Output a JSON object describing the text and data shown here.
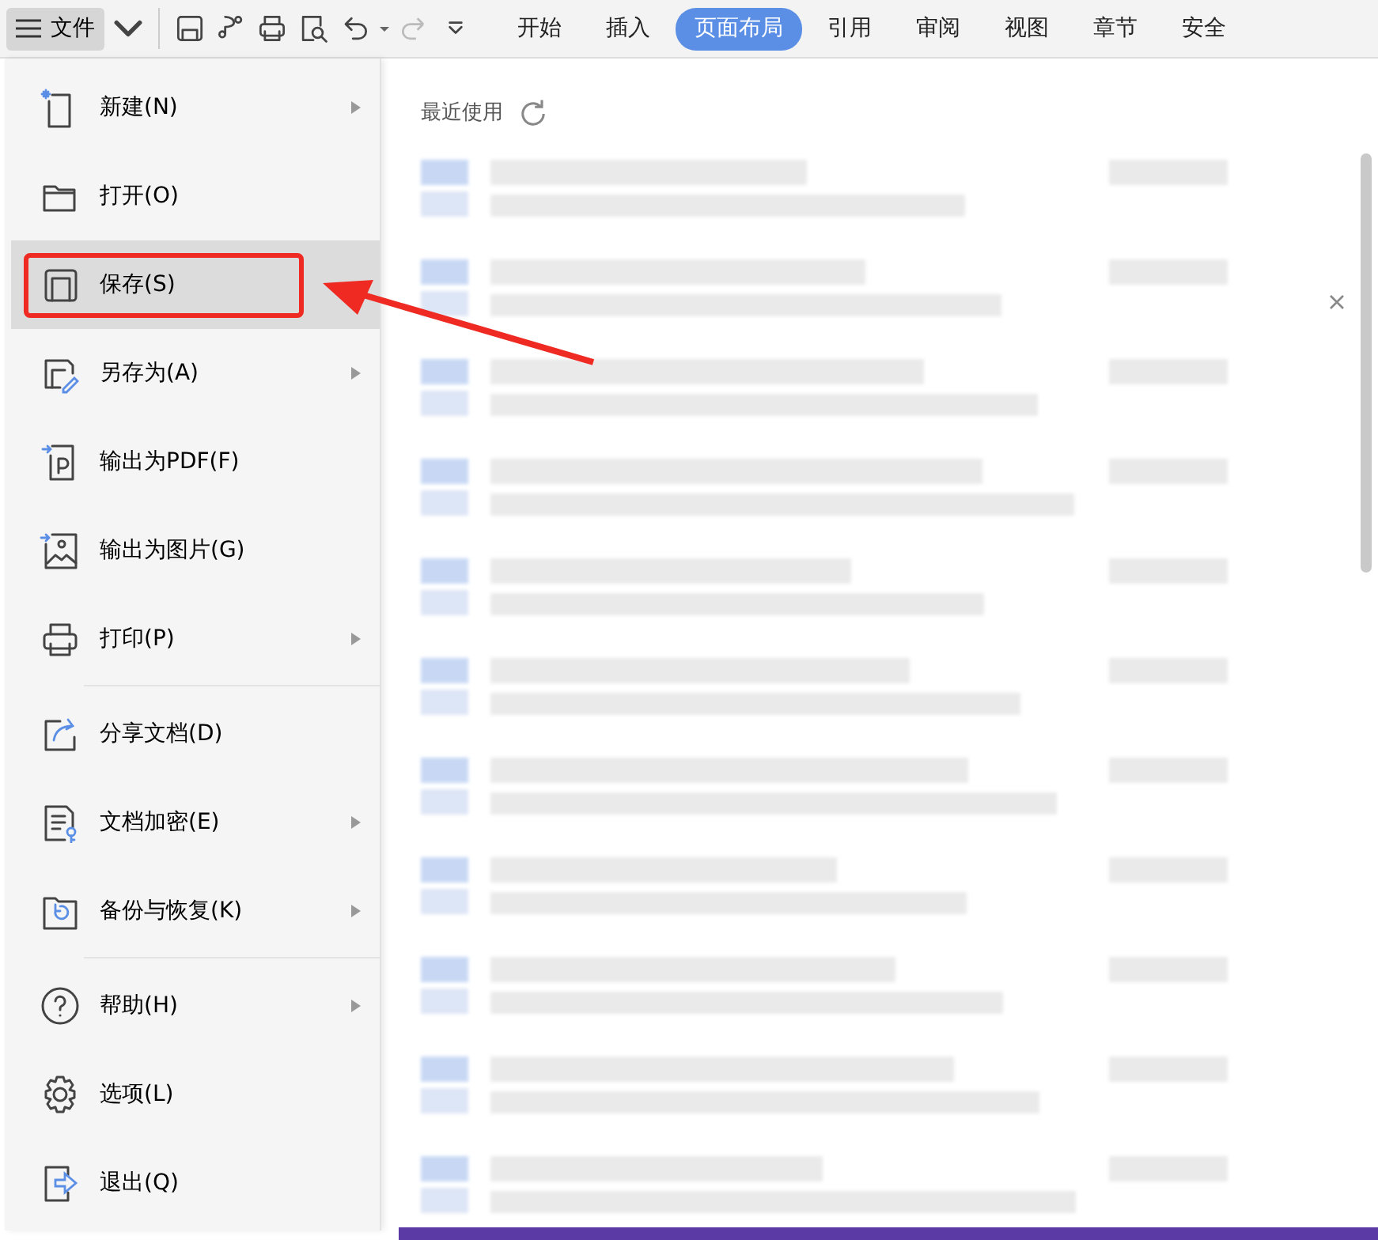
{
  "toolbar": {
    "file_menu": {
      "label": "文件",
      "selected": true
    },
    "redo_disabled": true
  },
  "tabs": [
    {
      "label": "开始",
      "selected": false
    },
    {
      "label": "插入",
      "selected": false
    },
    {
      "label": "页面布局",
      "selected": true
    },
    {
      "label": "引用",
      "selected": false
    },
    {
      "label": "审阅",
      "selected": false
    },
    {
      "label": "视图",
      "selected": false
    },
    {
      "label": "章节",
      "selected": false
    },
    {
      "label": "安全",
      "selected": false
    }
  ],
  "menu_groups": [
    [
      {
        "label": "新建(N)",
        "submenu": true,
        "selected": false
      },
      {
        "label": "打开(O)",
        "submenu": false,
        "selected": false
      },
      {
        "label": "保存(S)",
        "submenu": false,
        "selected": true
      },
      {
        "label": "另存为(A)",
        "submenu": true,
        "selected": false
      },
      {
        "label": "输出为PDF(F)",
        "submenu": false,
        "selected": false
      },
      {
        "label": "输出为图片(G)",
        "submenu": false,
        "selected": false
      },
      {
        "label": "打印(P)",
        "submenu": true,
        "selected": false
      }
    ],
    [
      {
        "label": "分享文档(D)",
        "submenu": false,
        "selected": false
      },
      {
        "label": "文档加密(E)",
        "submenu": true,
        "selected": false
      },
      {
        "label": "备份与恢复(K)",
        "submenu": true,
        "selected": false
      }
    ],
    [
      {
        "label": "帮助(H)",
        "submenu": true,
        "selected": false
      },
      {
        "label": "选项(L)",
        "submenu": false,
        "selected": false
      },
      {
        "label": "退出(Q)",
        "submenu": false,
        "selected": false
      }
    ]
  ],
  "recent": {
    "title": "最近使用"
  }
}
